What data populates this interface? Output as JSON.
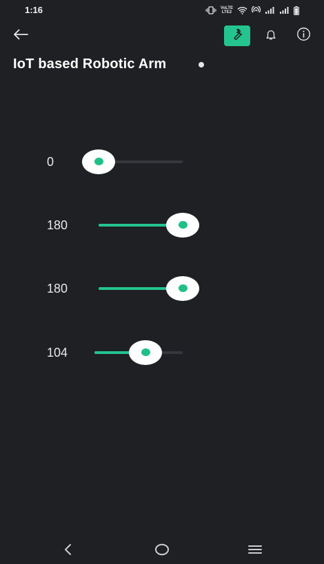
{
  "status_bar": {
    "time": "1:16",
    "network_label_top": "VoLTE",
    "network_label_bottom": "LTE2",
    "icons": [
      "vibrate-icon",
      "volte-icon",
      "wifi-icon",
      "hotspot-icon",
      "signal-icon",
      "signal-icon",
      "battery-icon"
    ]
  },
  "header": {
    "title": "IoT based Robotic Arm",
    "back_icon": "arrow-left-icon",
    "wrench_icon": "wrench-icon",
    "bell_icon": "bell-icon",
    "info_icon": "info-icon",
    "accent_color": "#23c48e"
  },
  "sliders": [
    {
      "value_label": "0",
      "value": 0,
      "min": 0,
      "max": 180
    },
    {
      "value_label": "180",
      "value": 180,
      "min": 0,
      "max": 180
    },
    {
      "value_label": "180",
      "value": 180,
      "min": 0,
      "max": 180
    },
    {
      "value_label": "104",
      "value": 104,
      "min": 0,
      "max": 180
    }
  ],
  "nav_bar": {
    "icons": [
      "nav-back-icon",
      "nav-home-icon",
      "nav-menu-icon"
    ]
  },
  "colors": {
    "background": "#1f2024",
    "track": "#37383d",
    "fill": "#23c48e",
    "thumb": "#ffffff"
  }
}
